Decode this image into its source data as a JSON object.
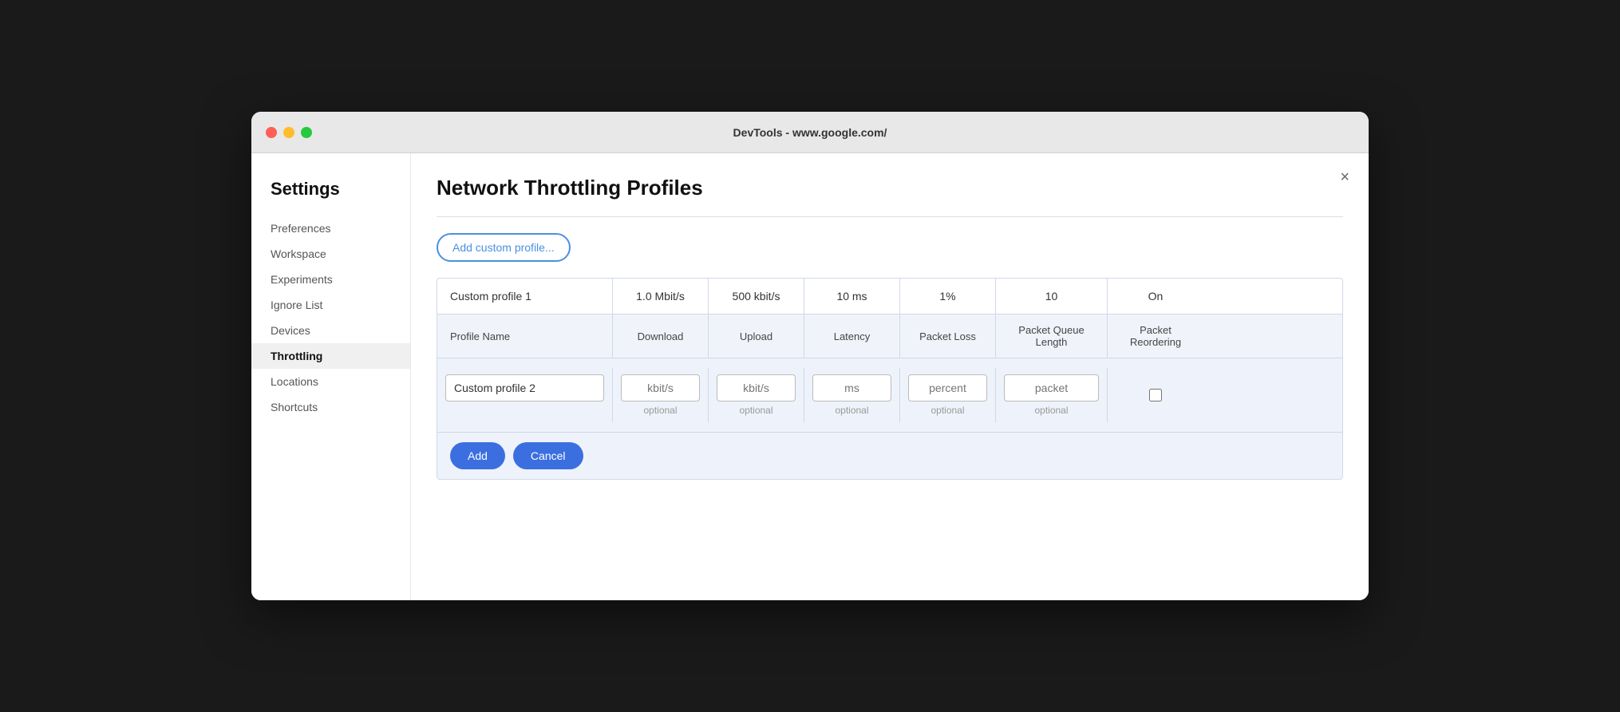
{
  "window": {
    "title": "DevTools - www.google.com/"
  },
  "sidebar": {
    "title": "Settings",
    "items": [
      {
        "label": "Preferences",
        "active": false
      },
      {
        "label": "Workspace",
        "active": false
      },
      {
        "label": "Experiments",
        "active": false
      },
      {
        "label": "Ignore List",
        "active": false
      },
      {
        "label": "Devices",
        "active": false
      },
      {
        "label": "Throttling",
        "active": true
      },
      {
        "label": "Locations",
        "active": false
      },
      {
        "label": "Shortcuts",
        "active": false
      }
    ]
  },
  "main": {
    "title": "Network Throttling Profiles",
    "add_button_label": "Add custom profile...",
    "close_icon": "×",
    "table": {
      "existing_profile": {
        "name": "Custom profile 1",
        "download": "1.0 Mbit/s",
        "upload": "500 kbit/s",
        "latency": "10 ms",
        "packet_loss": "1%",
        "packet_queue": "10",
        "reordering": "On"
      },
      "headers": {
        "name": "Profile Name",
        "download": "Download",
        "upload": "Upload",
        "latency": "Latency",
        "packet_loss": "Packet Loss",
        "packet_queue": "Packet Queue Length",
        "reordering": "Packet Reordering"
      },
      "new_profile": {
        "name_value": "Custom profile 2",
        "name_placeholder": "",
        "download_placeholder": "kbit/s",
        "upload_placeholder": "kbit/s",
        "latency_placeholder": "ms",
        "packet_loss_placeholder": "percent",
        "packet_queue_placeholder": "packet",
        "download_hint": "optional",
        "upload_hint": "optional",
        "latency_hint": "optional",
        "packet_loss_hint": "optional",
        "packet_queue_hint": "optional"
      }
    },
    "buttons": {
      "add": "Add",
      "cancel": "Cancel"
    }
  }
}
